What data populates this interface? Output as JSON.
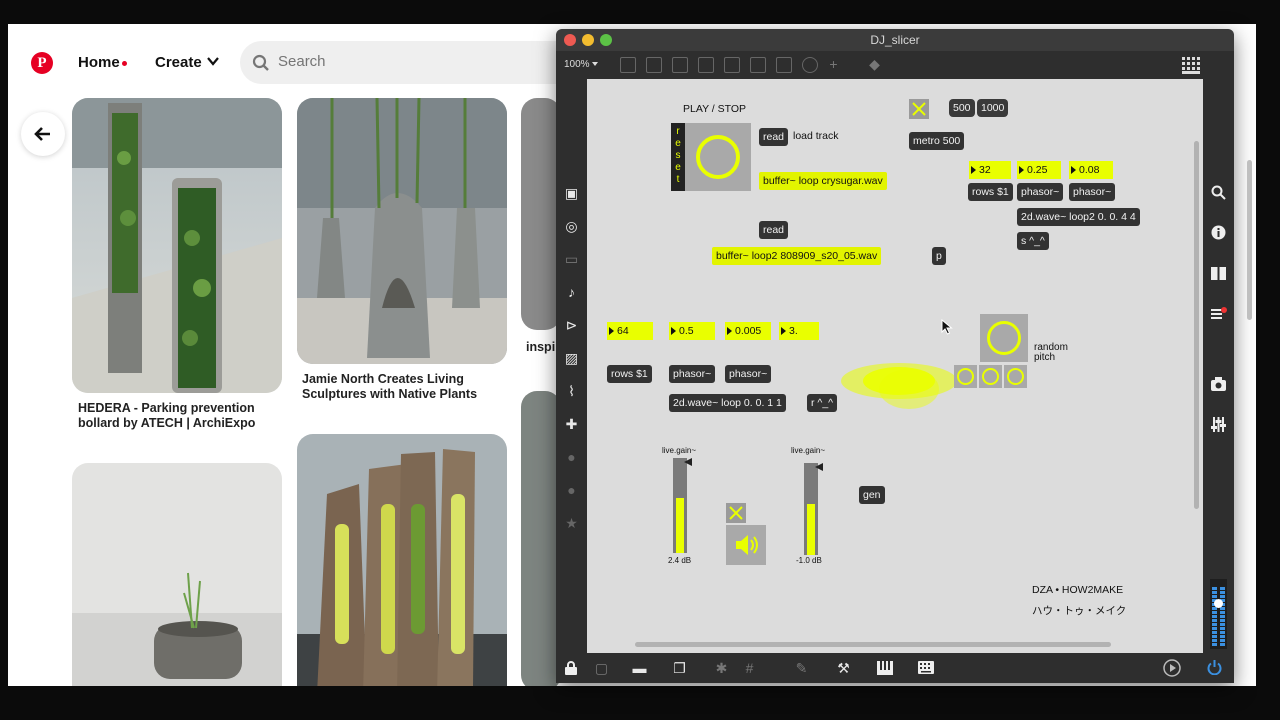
{
  "browser": {
    "logo": "P",
    "nav": {
      "home": "Home",
      "create": "Create"
    },
    "search": {
      "placeholder": "Search"
    },
    "pins": [
      {
        "title": "HEDERA - Parking prevention bollard by ATECH | ArchiExpo"
      },
      {
        "title": "Jamie North Creates Living Sculptures with Native Plants"
      },
      {
        "title": "inspi"
      }
    ]
  },
  "max": {
    "window_title": "DJ_slicer",
    "zoom": "100%",
    "objects": {
      "play_stop": "PLAY / STOP",
      "reset": "r\ne\ns\ne\nt",
      "read1": "read",
      "load_track": "load track",
      "buffer1": "buffer~ loop crysugar.wav",
      "read2": "read",
      "buffer2": "buffer~ loop2 808909_s20_05.wav",
      "msg500": "500",
      "msg1000": "1000",
      "metro": "metro 500",
      "num32": "32",
      "num025": "0.25",
      "num008": "0.08",
      "rows_a": "rows $1",
      "phasor_a1": "phasor~",
      "phasor_a2": "phasor~",
      "wave_a": "2d.wave~ loop2 0. 0. 4 4",
      "send": "s ^_^",
      "p": "p",
      "num64": "64",
      "num05": "0.5",
      "num0005": "0.005",
      "num3": "3.",
      "rows_b": "rows $1",
      "phasor_b1": "phasor~",
      "phasor_b2": "phasor~",
      "wave_b": "2d.wave~ loop 0. 0. 1 1",
      "receive": "r ^_^",
      "random_pitch": "random\npitch",
      "gain1_label": "live.gain~",
      "gain1_db": "2.4 dB",
      "gain2_label": "live.gain~",
      "gain2_db": "-1.0 dB",
      "gen": "gen",
      "credit1": "DZA • HOW2MAKE",
      "credit2": "ハウ・トゥ・メイク"
    },
    "gain1_level": 0.58,
    "gain2_level": 0.55,
    "icons": [
      "grid-icon",
      "search-icon",
      "info-icon",
      "book-icon",
      "list-icon",
      "camera-icon",
      "mixer-icon",
      "power-icon",
      "lock-icon",
      "wrench-icon",
      "keyboard-icon",
      "piano-icon"
    ]
  },
  "colors": {
    "accent": "#e9ff00",
    "pinterest": "#e60023",
    "dark": "#2e2e2e"
  }
}
